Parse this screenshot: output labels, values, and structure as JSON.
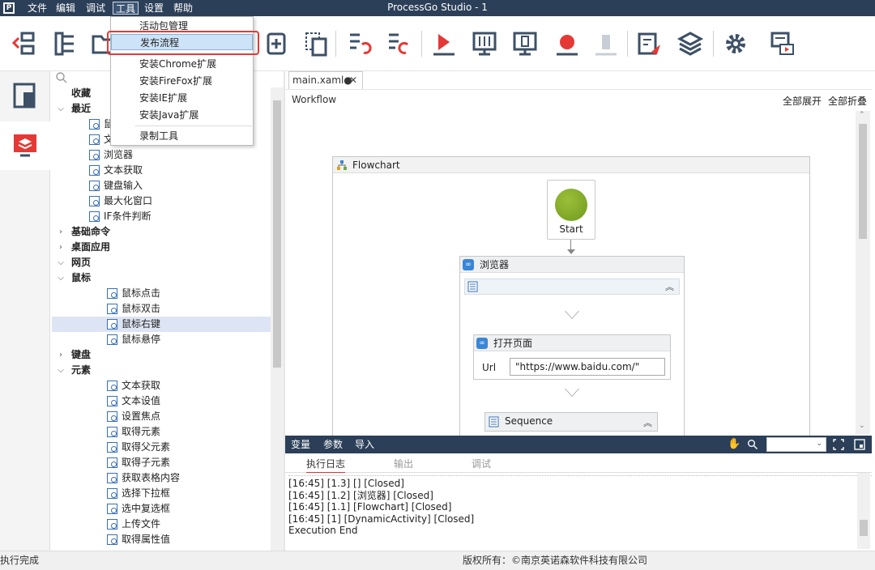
{
  "window": {
    "title": "ProcessGo Studio - 1"
  },
  "menubar": [
    "文件",
    "编辑",
    "调试",
    "工具",
    "设置",
    "帮助"
  ],
  "tools_menu": {
    "items": [
      "活动包管理",
      "发布流程",
      "安装Chrome扩展",
      "安装FireFox扩展",
      "安装IE扩展",
      "安装Java扩展",
      "录制工具"
    ],
    "highlighted": "发布流程"
  },
  "tree": {
    "rows": [
      {
        "label": "收藏",
        "level": 0,
        "bold": true
      },
      {
        "label": "最近",
        "level": 0,
        "bold": true,
        "arrow": "down"
      },
      {
        "label": "鼠",
        "level": 2,
        "icon": true
      },
      {
        "label": "文",
        "level": 2,
        "icon": true
      },
      {
        "label": "浏览器",
        "level": 2,
        "icon": true
      },
      {
        "label": "文本获取",
        "level": 2,
        "icon": true
      },
      {
        "label": "键盘输入",
        "level": 2,
        "icon": true
      },
      {
        "label": "最大化窗口",
        "level": 2,
        "icon": true
      },
      {
        "label": "IF条件判断",
        "level": 2,
        "icon": true
      },
      {
        "label": "基础命令",
        "level": 0,
        "bold": true,
        "arrow": "right"
      },
      {
        "label": "桌面应用",
        "level": 0,
        "bold": true,
        "arrow": "right"
      },
      {
        "label": "网页",
        "level": 0,
        "bold": true,
        "arrow": "down"
      },
      {
        "label": "鼠标",
        "level": 1,
        "bold": true,
        "arrow": "down"
      },
      {
        "label": "鼠标点击",
        "level": 3,
        "icon": true
      },
      {
        "label": "鼠标双击",
        "level": 3,
        "icon": true
      },
      {
        "label": "鼠标右键",
        "level": 3,
        "icon": true,
        "selected": true
      },
      {
        "label": "鼠标悬停",
        "level": 3,
        "icon": true
      },
      {
        "label": "键盘",
        "level": 1,
        "bold": true,
        "arrow": "right"
      },
      {
        "label": "元素",
        "level": 1,
        "bold": true,
        "arrow": "down"
      },
      {
        "label": "文本获取",
        "level": 3,
        "icon": true
      },
      {
        "label": "文本设值",
        "level": 3,
        "icon": true
      },
      {
        "label": "设置焦点",
        "level": 3,
        "icon": true
      },
      {
        "label": "取得元素",
        "level": 3,
        "icon": true
      },
      {
        "label": "取得父元素",
        "level": 3,
        "icon": true
      },
      {
        "label": "取得子元素",
        "level": 3,
        "icon": true
      },
      {
        "label": "获取表格内容",
        "level": 3,
        "icon": true
      },
      {
        "label": "选择下拉框",
        "level": 3,
        "icon": true
      },
      {
        "label": "选中复选框",
        "level": 3,
        "icon": true
      },
      {
        "label": "上传文件",
        "level": 3,
        "icon": true
      },
      {
        "label": "取得属性值",
        "level": 3,
        "icon": true
      }
    ]
  },
  "doc_tab": {
    "label": "main.xaml●",
    "close": "✕"
  },
  "workflow": {
    "label": "Workflow",
    "expand_all": "全部展开",
    "collapse_all": "全部折叠",
    "flowchart_title": "Flowchart",
    "start_label": "Start",
    "browser_activity": "浏览器",
    "open_page_activity": "打开页面",
    "url_label": "Url",
    "url_value": "\"https://www.baidu.com/\"",
    "sequence_label": "Sequence"
  },
  "var_bar": {
    "tabs": [
      "变量",
      "参数",
      "导入"
    ]
  },
  "log_tabs": [
    "执行日志",
    "输出",
    "调试"
  ],
  "log_lines": [
    "[16:45] [1.3] []  [Closed]",
    "[16:45] [1.2] [浏览器]  [Closed]",
    "[16:45] [1.1] [Flowchart]  [Closed]",
    "[16:45] [1] [DynamicActivity]  [Closed]",
    "Execution End"
  ],
  "status": {
    "left": "执行完成",
    "copyright": "版权所有：©南京英诺森软件科技有限公司"
  },
  "colors": {
    "titlebar": "#2b3f58",
    "highlight_box": "#e53935",
    "icon_blue": "#3a6fb5"
  }
}
